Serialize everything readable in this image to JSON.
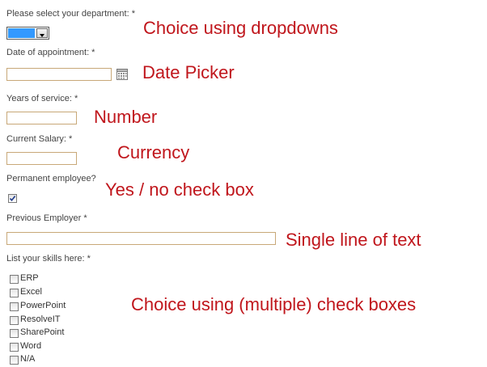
{
  "form": {
    "department_label": "Please select your department: *",
    "date_label": "Date of appointment: *",
    "years_label": "Years of service: *",
    "salary_label": "Current Salary: *",
    "permanent_label": "Permanent employee?",
    "previous_employer_label": "Previous Employer *",
    "skills_label": "List your skills here: *",
    "department_value": "",
    "date_value": "",
    "years_value": "",
    "salary_value": "",
    "previous_employer_value": "",
    "permanent_checked": true,
    "skills": [
      {
        "label": "ERP",
        "checked": false
      },
      {
        "label": "Excel",
        "checked": false
      },
      {
        "label": "PowerPoint",
        "checked": false
      },
      {
        "label": "ResolveIT",
        "checked": false
      },
      {
        "label": "SharePoint",
        "checked": false
      },
      {
        "label": "Word",
        "checked": false
      },
      {
        "label": "N/A",
        "checked": false
      }
    ]
  },
  "annotations": {
    "dropdown": "Choice using dropdowns",
    "date": "Date Picker",
    "number": "Number",
    "currency": "Currency",
    "checkbox": "Yes / no check box",
    "text": "Single line of text",
    "multi": "Choice using (multiple) check boxes"
  },
  "icons": {
    "date_picker": "calendar-icon",
    "dropdown_arrow": "chevron-down-icon",
    "check": "checkmark-icon"
  },
  "colors": {
    "annotation": "#c0161c",
    "field_border": "#c8a878",
    "dropdown_selection": "#3399ff"
  }
}
